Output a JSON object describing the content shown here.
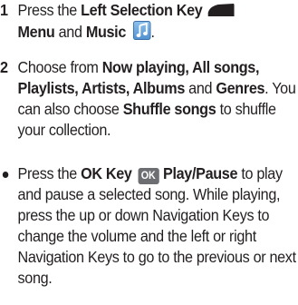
{
  "steps": [
    {
      "number": "1",
      "t1": "Press the ",
      "b1": "Left Selection Key",
      "b2": "Menu",
      "t2": " and ",
      "b3": "Music",
      "t3": "."
    },
    {
      "number": "2",
      "t1": "Choose from ",
      "b1": "Now playing, All songs, Playlists, Artists, Albums",
      "t2": " and ",
      "b2": "Genres",
      "t3": ". You can also choose ",
      "b3": "Shuffle songs",
      "t4": " to shuffle your collection."
    },
    {
      "t1": "Press the ",
      "b1": "OK Key",
      "key_label": "OK",
      "b2": "Play/Pause",
      "t2": " to play and pause a selected song. While playing, press the up or down Navigation Keys to change the volume and the left or right Navigation Keys to go to the previous or next song."
    }
  ],
  "icons": {
    "left_selection_key": "left-selection-key-icon",
    "music_app": "music-app-icon",
    "ok_key": "ok-key-icon",
    "bullet": "bullet-icon"
  },
  "colors": {
    "text": "#231f20",
    "music_icon": "#4f8fd0",
    "ok_key": "#6d6e71"
  }
}
